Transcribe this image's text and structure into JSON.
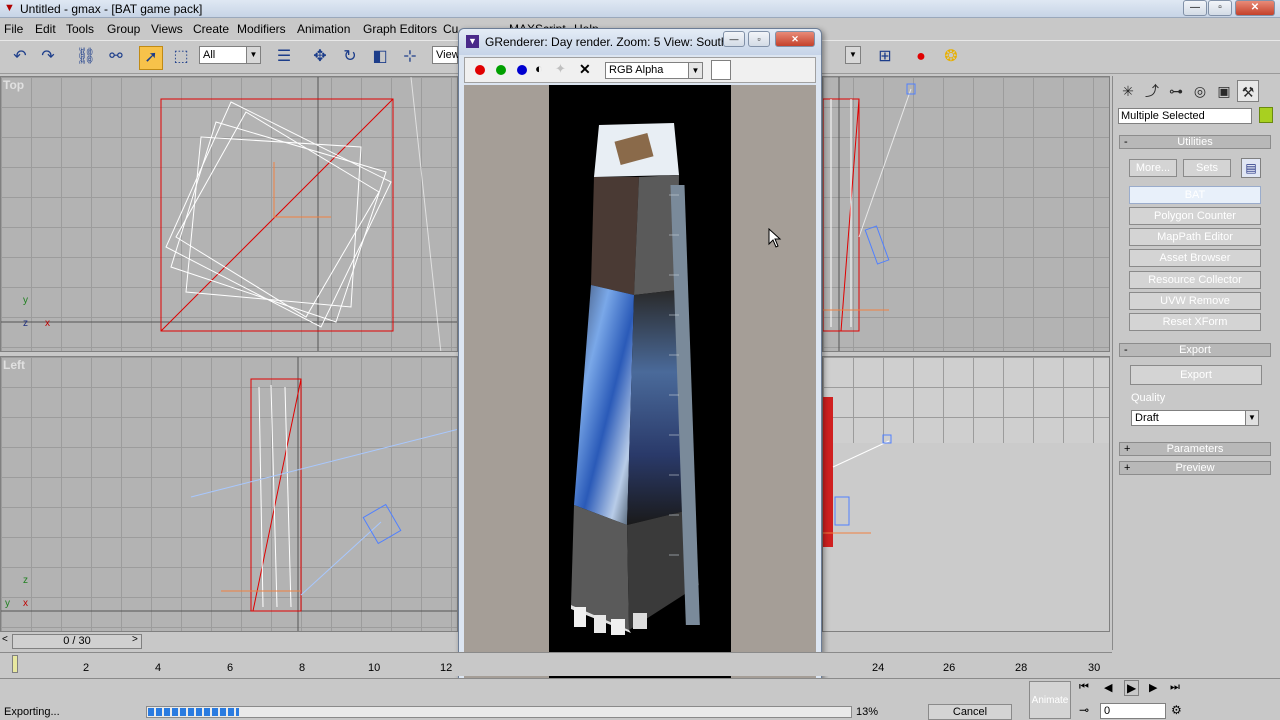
{
  "window": {
    "title": "Untitled - gmax - [BAT game pack]",
    "min_label": "—",
    "max_label": "▫",
    "close_label": "✕"
  },
  "menu": [
    "File",
    "Edit",
    "Tools",
    "Group",
    "Views",
    "Create",
    "Modifiers",
    "Animation",
    "Graph Editors",
    "Cu...",
    "MAXScript",
    "Help"
  ],
  "toolbar": {
    "selection_filter": "All",
    "view_dropdown": "View"
  },
  "viewports": {
    "top_label": "Top",
    "left_label": "Left"
  },
  "render_window": {
    "title": "GRenderer: Day render. Zoom: 5 View: South ...",
    "channel_select": "RGB Alpha",
    "clear_label": "✕"
  },
  "command_panel": {
    "selection_name": "Multiple Selected",
    "utilities_header": "Utilities",
    "more_button": "More...",
    "sets_button": "Sets",
    "active_button": "BAT",
    "buttons": [
      "Polygon Counter",
      "MapPath Editor",
      "Asset Browser",
      "Resource Collector",
      "UVW Remove",
      "Reset XForm"
    ],
    "export_header": "Export",
    "export_button": "Export",
    "quality_label": "Quality",
    "quality_value": "Draft",
    "parameters_header": "Parameters",
    "preview_header": "Preview"
  },
  "timeline": {
    "frame_display": "0 / 30",
    "ticks_left": [
      "2",
      "4",
      "6",
      "8",
      "10",
      "12"
    ],
    "ticks_right": [
      "24",
      "26",
      "28",
      "30"
    ]
  },
  "status": {
    "text": "Exporting...",
    "progress_percent": "13%",
    "progress_fraction": 0.13,
    "cancel_button": "Cancel",
    "animate_button": "Animate",
    "frame_field": "0"
  },
  "colors": {
    "active_tool": "#f7c24a",
    "channel_red": "#e00000",
    "channel_green": "#00a000",
    "channel_blue": "#0000d0",
    "progress": "#2a7be0"
  }
}
